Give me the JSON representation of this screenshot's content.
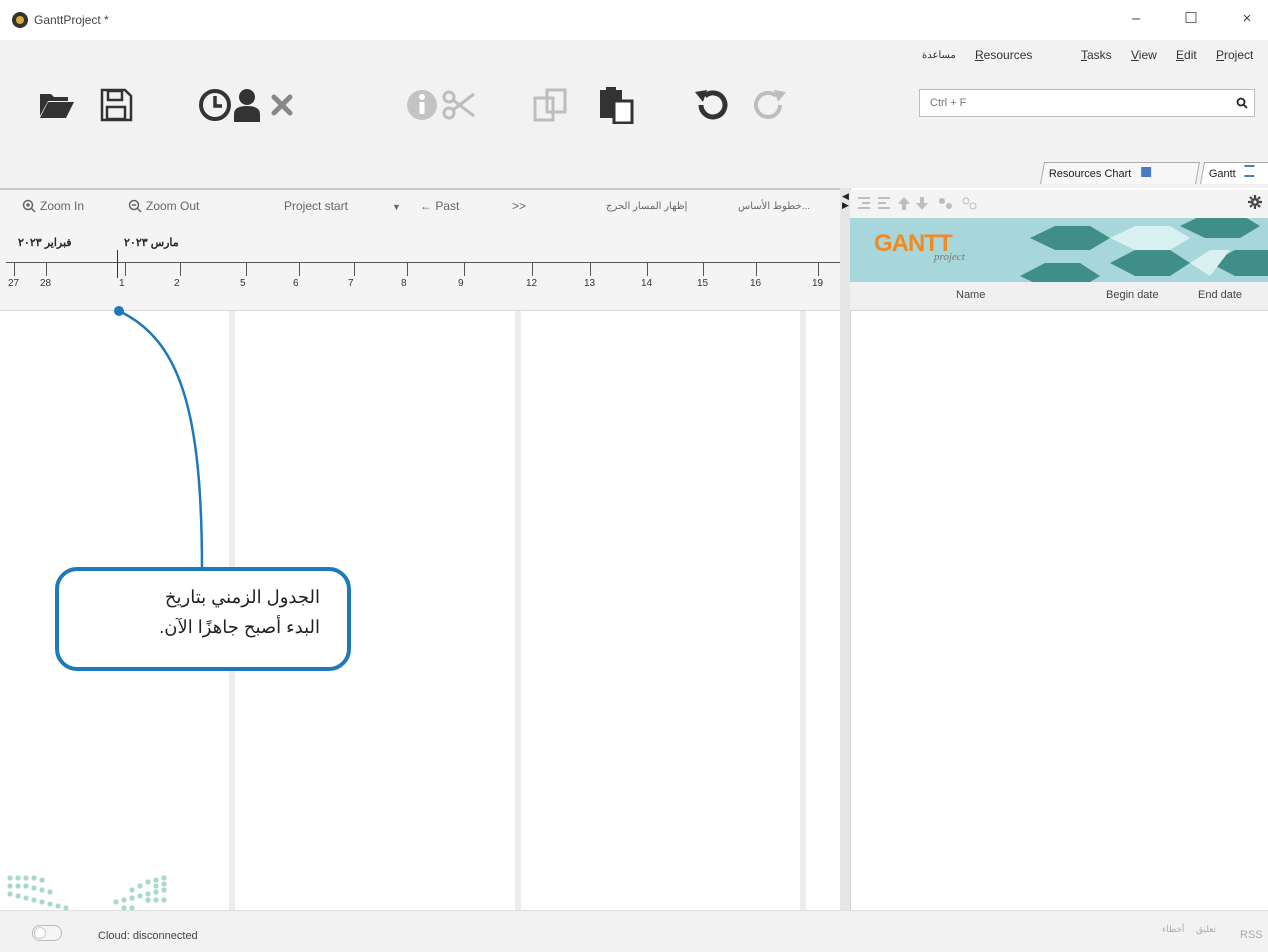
{
  "window": {
    "title": "GanttProject *",
    "controls": {
      "minimize": "–",
      "maximize": "☐",
      "close": "×"
    }
  },
  "menu": {
    "items": [
      "Project",
      "Edit",
      "View",
      "Tasks",
      "Resources",
      "مساعدة"
    ]
  },
  "toolbar": {
    "icons": [
      "open-folder",
      "save",
      "history",
      "user",
      "delete",
      "info",
      "cut",
      "copy",
      "paste",
      "undo",
      "redo"
    ],
    "search_placeholder": "Ctrl + F"
  },
  "view_tabs": {
    "resources_chart": "Resources Chart",
    "gantt": "Gantt"
  },
  "chart_toolbar": {
    "zoom_in": "Zoom In",
    "zoom_out": "Zoom Out",
    "project_start": "Project start",
    "past": "← Past",
    "next": ">>",
    "show_critical_path": "إظهار المسار الحرج",
    "baselines": "خطوط الأساس..."
  },
  "timeline": {
    "months": [
      "فبراير ٢٠٢٣",
      "مارس ٢٠٢٣"
    ],
    "days": [
      "27",
      "28",
      "1",
      "2",
      "5",
      "6",
      "7",
      "8",
      "9",
      "12",
      "13",
      "14",
      "15",
      "16",
      "19"
    ]
  },
  "task_table": {
    "columns": [
      "Name",
      "Begin date",
      "End date"
    ],
    "banner_text": "GANTT",
    "banner_subtext": "project"
  },
  "status": {
    "cloud": "Cloud: disconnected",
    "right_items": [
      "RSS",
      "تعليق",
      "أخطاء"
    ]
  },
  "callout": {
    "line1": "الجدول الزمني بتاريخ",
    "line2": "البدء أصبح جاهزًا الآن."
  },
  "colors": {
    "accent": "#1d79bb",
    "toolbar_icon": "#333333",
    "disabled_icon": "#bdbdbd"
  }
}
